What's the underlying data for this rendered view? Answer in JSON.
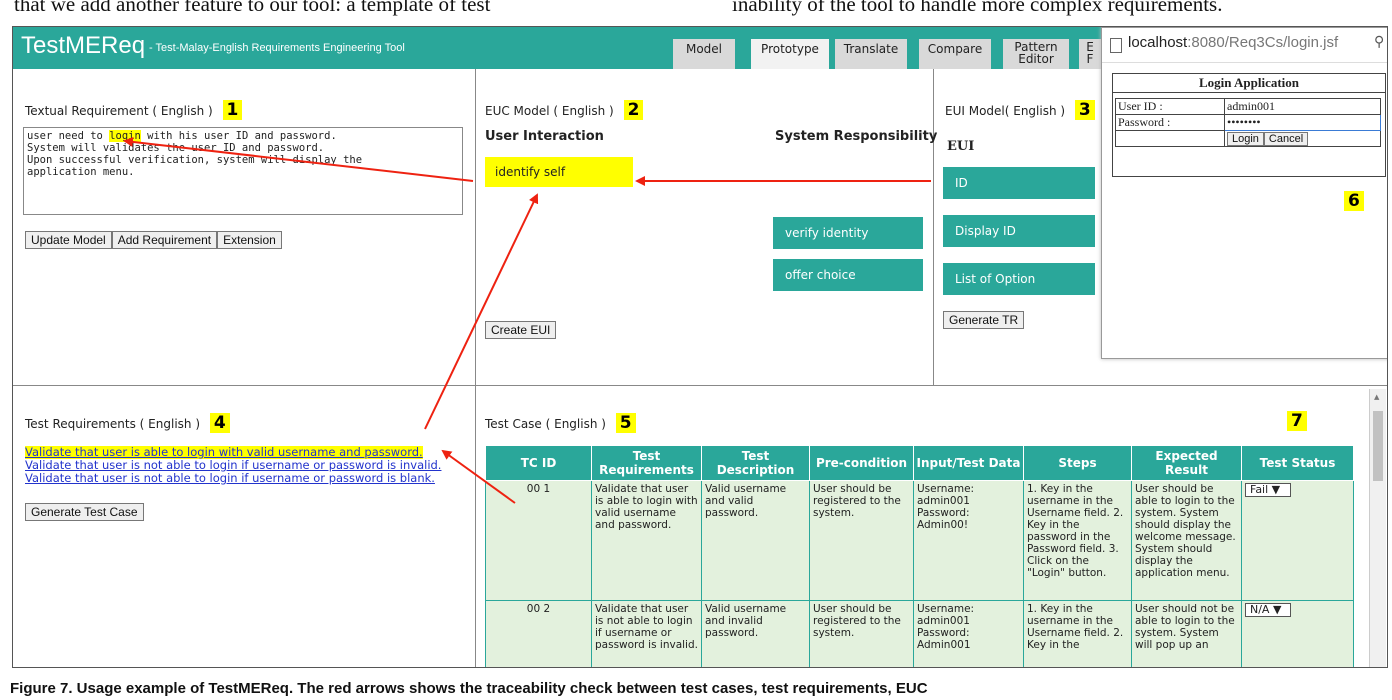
{
  "paper": {
    "top_left_text": "that we add another feature to our tool: a template of test",
    "top_right_text": "inability of the tool to handle more complex requirements.",
    "caption": "Figure 7. Usage example of TestMEReq. The red arrows shows the traceability check between test cases, test requirements, EUC"
  },
  "app": {
    "title": "TestMEReq",
    "subtitle": "- Test-Malay-English Requirements Engineering Tool",
    "tabs": [
      "Model",
      "Prototype",
      "Translate",
      "Compare",
      "Pattern Editor",
      "E"
    ],
    "active_tab": "Prototype",
    "tab_r_glyph": "F"
  },
  "textual": {
    "heading": "Textual Requirement ( English )",
    "badge": "1",
    "lines": [
      {
        "pre": "user need to ",
        "hl": "login",
        "post": " with his user ID and password."
      },
      {
        "pre": "System will validates the user ID and password.",
        "hl": "",
        "post": ""
      },
      {
        "pre": "Upon successful verification, system will display the",
        "hl": "",
        "post": ""
      },
      {
        "pre": "application menu.",
        "hl": "",
        "post": ""
      }
    ],
    "buttons": [
      "Update Model",
      "Add Requirement",
      "Extension"
    ]
  },
  "euc": {
    "heading": "EUC Model ( English )",
    "badge": "2",
    "col_left": "User Interaction",
    "col_right": "System Responsibility",
    "user_item": "identify self",
    "system_items": [
      "verify identity",
      "offer choice"
    ],
    "button": "Create EUI"
  },
  "eui": {
    "heading": "EUI Model( English )",
    "badge": "3",
    "label": "EUI",
    "items": [
      "ID",
      "Display ID",
      "List of Option"
    ],
    "button": "Generate TR"
  },
  "browser": {
    "url_host": "localhost",
    "url_rest": ":8080/Req3Cs/login.jsf",
    "title": "Login Application",
    "user_label": "User ID :",
    "user_value": "admin001",
    "pass_label": "Password :",
    "pass_value": "••••••••",
    "login_btn": "Login",
    "cancel_btn": "Cancel",
    "badge": "6"
  },
  "test_req": {
    "heading": "Test Requirements ( English )",
    "badge": "4",
    "links": [
      "Validate that user is able to login with valid username and password.",
      "Validate that user is not able to login if username or password is invalid.",
      "Validate that user is not able to login if username or password is blank."
    ],
    "button": "Generate Test Case"
  },
  "test_case": {
    "heading": "Test Case ( English )",
    "badge": "5",
    "status_badge": "7",
    "columns": [
      "TC ID",
      "Test Requirements",
      "Test Description",
      "Pre-condition",
      "Input/Test Data",
      "Steps",
      "Expected Result",
      "Test Status"
    ],
    "rows": [
      {
        "id": "00 1",
        "req": "Validate that user is able to login with valid username and password.",
        "desc": "Valid username and valid password.",
        "pre": "User should be registered to the system.",
        "input": "Username: admin001 Password: Admin00!",
        "steps": "1. Key in the username in the Username field. 2. Key in the password in the Password field. 3. Click on the \"Login\" button.",
        "expected": "User should be able to login to the system. System should display the welcome message. System should display the application menu.",
        "status": "Fail"
      },
      {
        "id": "00 2",
        "req": "Validate that user is not able to login if username or password is invalid.",
        "desc": "Valid username and invalid password.",
        "pre": "User should be registered to the system.",
        "input": "Username: admin001 Password: Admin001",
        "steps": "1. Key in the username in the Username field. 2. Key in the",
        "expected": "User should not be able to login to the system. System will pop up an",
        "status": "N/A"
      }
    ]
  },
  "colors": {
    "teal": "#2aa79a",
    "highlight": "#ffff00",
    "arrow": "#ee2211",
    "table_cell": "#e3f1dd"
  }
}
